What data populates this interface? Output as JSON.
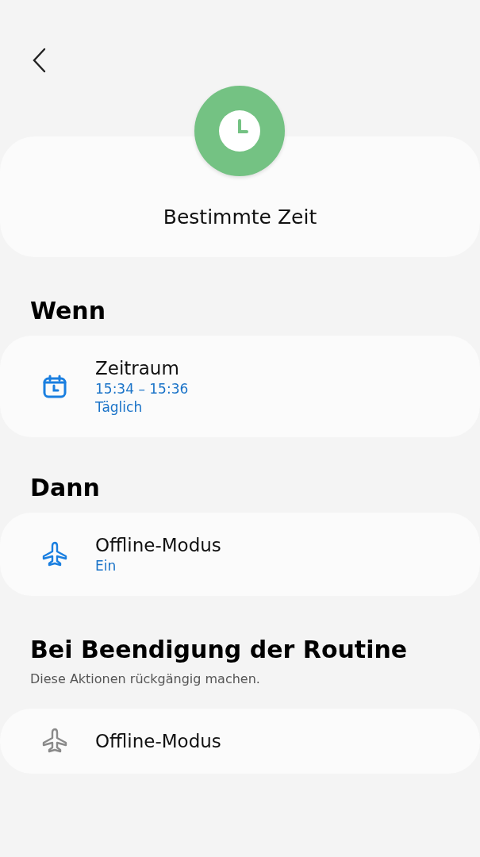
{
  "header": {
    "title": "Bestimmte Zeit"
  },
  "sections": [
    {
      "heading": "Wenn",
      "items": [
        {
          "kind": "calendar",
          "dimmed": false,
          "title": "Zeitraum",
          "details": [
            "15:34 – 15:36",
            "Täglich"
          ]
        }
      ]
    },
    {
      "heading": "Dann",
      "items": [
        {
          "kind": "airplane",
          "dimmed": false,
          "title": "Offline-Modus",
          "details": [
            "Ein"
          ]
        }
      ]
    },
    {
      "heading": "Bei Beendigung der Routine",
      "subtitle": "Diese Aktionen rückgängig machen.",
      "items": [
        {
          "kind": "airplane",
          "dimmed": true,
          "title": "Offline-Modus"
        }
      ]
    }
  ]
}
